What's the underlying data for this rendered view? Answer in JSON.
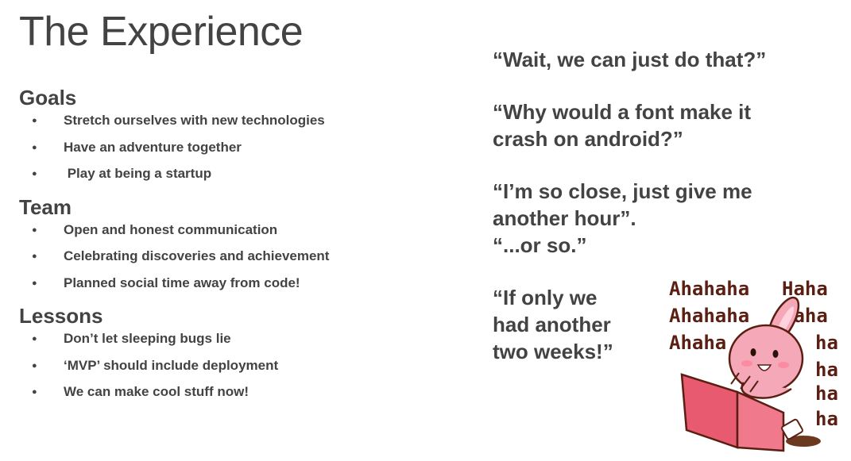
{
  "title": "The Experience",
  "sections": [
    {
      "heading": "Goals",
      "items": [
        "Stretch ourselves with new technologies",
        "Have an adventure together",
        " Play at being a startup"
      ]
    },
    {
      "heading": "Team",
      "items": [
        "Open and honest communication",
        "Celebrating discoveries and achievement",
        "Planned social time away from code!"
      ]
    },
    {
      "heading": "Lessons",
      "items": [
        "Don’t let sleeping bugs lie",
        "‘MVP’ should include deployment",
        "We can make cool stuff now!"
      ]
    }
  ],
  "quotes": [
    {
      "lines": [
        "“Wait, we can just do that?”"
      ]
    },
    {
      "lines": [
        "“Why would a font make it",
        "crash on android?”"
      ]
    },
    {
      "lines": [
        "“I’m so close, just give me",
        "another hour”.",
        "“...or so.”"
      ]
    },
    {
      "lines": [
        "“If only we",
        "had another",
        "two weeks!”"
      ]
    }
  ],
  "sticker": {
    "lines": [
      "Ahahaha",
      "Haha",
      "Ahahaha",
      "Haha",
      "Ahaha",
      "ha",
      "ha",
      "ha",
      "ha"
    ],
    "colors": {
      "text": "#5a1f12",
      "bunny": "#f5a9b8",
      "laptop": "#e85a70"
    }
  }
}
